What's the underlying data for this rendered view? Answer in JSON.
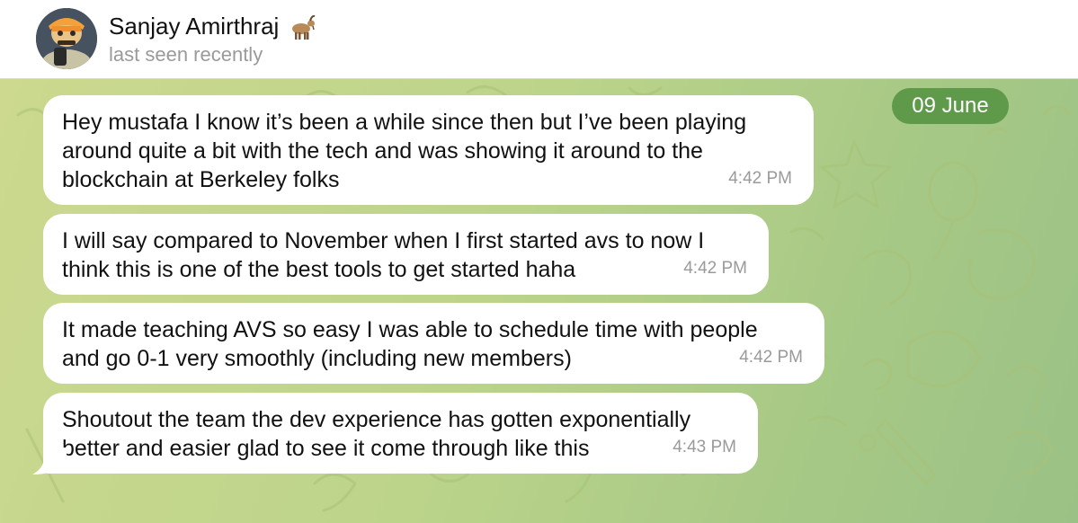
{
  "header": {
    "contact_name": "Sanjay Amirthraj",
    "name_emoji": "goat-emoji",
    "status": "last seen recently",
    "avatar": "avatar-image"
  },
  "chat": {
    "date_label": "09 June",
    "messages": [
      {
        "text": "Hey mustafa I know it’s been a while since then but I’ve been playing\naround quite a bit with the tech and was showing it around to the\nblockchain at Berkeley folks",
        "time": "4:42 PM"
      },
      {
        "text": "I will say compared to November when I first started avs to now I\nthink this is one of the best tools to get started haha",
        "time": "4:42 PM"
      },
      {
        "text": "It made teaching AVS so easy I was able to schedule time with people\nand go 0-1 very smoothly (including new members)",
        "time": "4:42 PM"
      },
      {
        "text": "Shoutout the team the dev experience has gotten exponentially\nbetter and easier glad to see it come through like this",
        "time": "4:43 PM"
      }
    ]
  },
  "colors": {
    "date_pill": "#5f9a4a",
    "bubble": "#ffffff",
    "background_start": "#ccd98f",
    "background_end": "#9bc186"
  }
}
